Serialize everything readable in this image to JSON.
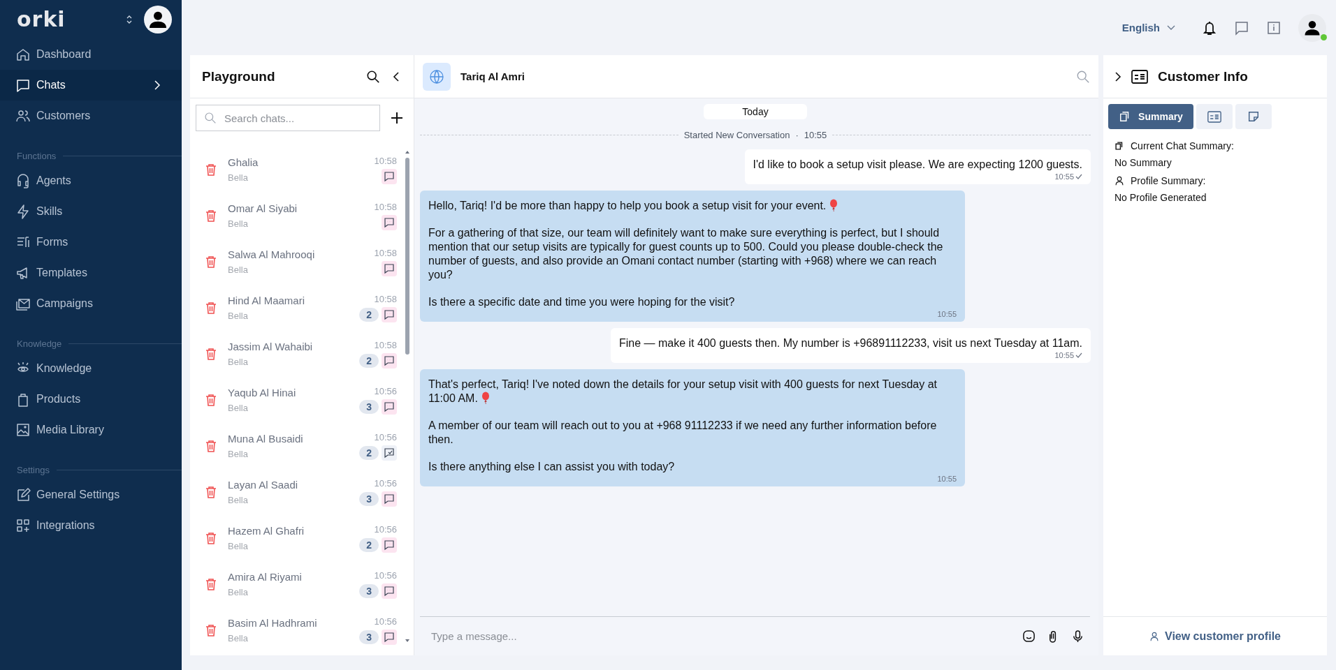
{
  "sidebar": {
    "logo": "orki",
    "sections": [
      {
        "items": [
          {
            "label": "Dashboard",
            "selected": false,
            "expandable": false
          },
          {
            "label": "Chats",
            "selected": true,
            "expandable": true
          },
          {
            "label": "Customers",
            "selected": false,
            "expandable": false
          }
        ]
      },
      {
        "title": "Functions",
        "items": [
          {
            "label": "Agents",
            "selected": false,
            "expandable": false
          },
          {
            "label": "Skills",
            "selected": false,
            "expandable": false
          },
          {
            "label": "Forms",
            "selected": false,
            "expandable": false
          },
          {
            "label": "Templates",
            "selected": false,
            "expandable": false
          },
          {
            "label": "Campaigns",
            "selected": false,
            "expandable": false
          }
        ]
      },
      {
        "title": "Knowledge",
        "items": [
          {
            "label": "Knowledge",
            "selected": false,
            "expandable": false
          },
          {
            "label": "Products",
            "selected": false,
            "expandable": false
          },
          {
            "label": "Media Library",
            "selected": false,
            "expandable": false
          }
        ]
      },
      {
        "title": "Settings",
        "items": [
          {
            "label": "General Settings",
            "selected": false,
            "expandable": false
          },
          {
            "label": "Integrations",
            "selected": false,
            "expandable": false
          }
        ]
      }
    ]
  },
  "top_bar": {
    "language": "English",
    "user_online": true
  },
  "chat_list": {
    "title": "Playground",
    "search": {
      "placeholder": "Search chats..."
    },
    "chats": [
      {
        "name": "Ghalia",
        "agent": "Bella",
        "time": "10:58",
        "kind": "open"
      },
      {
        "name": "Omar Al Siyabi",
        "agent": "Bella",
        "time": "10:58",
        "kind": "open"
      },
      {
        "name": "Salwa Al Mahrooqi",
        "agent": "Bella",
        "time": "10:58",
        "kind": "open"
      },
      {
        "name": "Hind Al Maamari",
        "agent": "Bella",
        "time": "10:58",
        "unread": "2",
        "kind": "open"
      },
      {
        "name": "Jassim Al Wahaibi",
        "agent": "Bella",
        "time": "10:58",
        "unread": "2",
        "kind": "open"
      },
      {
        "name": "Yaqub Al Hinai",
        "agent": "Bella",
        "time": "10:56",
        "unread": "3",
        "kind": "open"
      },
      {
        "name": "Muna Al Busaidi",
        "agent": "Bella",
        "time": "10:56",
        "unread": "2",
        "kind": "handled"
      },
      {
        "name": "Layan Al Saadi",
        "agent": "Bella",
        "time": "10:56",
        "unread": "3",
        "kind": "open"
      },
      {
        "name": "Hazem Al Ghafri",
        "agent": "Bella",
        "time": "10:56",
        "unread": "2",
        "kind": "open"
      },
      {
        "name": "Amira Al Riyami",
        "agent": "Bella",
        "time": "10:56",
        "unread": "3",
        "kind": "open"
      },
      {
        "name": "Basim Al Hadhrami",
        "agent": "Bella",
        "time": "10:56",
        "unread": "3",
        "kind": "open"
      }
    ]
  },
  "conversation": {
    "contact": "Tariq Al Amri",
    "date": "Today",
    "started": "Started New Conversation",
    "separator": "·",
    "started_time": "10:55",
    "messages": [
      {
        "kind": "customer",
        "paragraphs": [
          {
            "text": "I'd like to book a setup visit please. We are expecting 1200 guests.",
            "balloon": false
          }
        ],
        "time": "10:55"
      },
      {
        "kind": "agent",
        "paragraphs": [
          {
            "text": "Hello, Tariq! I'd be more than happy to help you book a setup visit for your event.",
            "balloon": true
          },
          {
            "text": "For a gathering of that size, our team will definitely want to make sure everything is perfect, but I should mention that our setup visits are typically for guest counts up to 500. Could you please double-check the number of guests, and also provide an Omani contact number (starting with +968) where we can reach you?",
            "balloon": false
          },
          {
            "text": "Is there a specific date and time you were hoping for the visit?",
            "balloon": false
          }
        ],
        "time": "10:55"
      },
      {
        "kind": "customer",
        "paragraphs": [
          {
            "text": "Fine — make it 400 guests then. My number is +96891112233, visit us next Tuesday at 11am.",
            "balloon": false
          }
        ],
        "time": "10:55"
      },
      {
        "kind": "agent",
        "paragraphs": [
          {
            "text": "That's perfect, Tariq! I've noted down the details for your setup visit with 400 guests for next Tuesday at 11:00 AM.",
            "balloon": true
          },
          {
            "text": "A member of our team will reach out to you at +968 91112233 if we need any further information before then.",
            "balloon": false
          },
          {
            "text": "Is there anything else I can assist you with today?",
            "balloon": false
          }
        ],
        "time": "10:55"
      }
    ],
    "composer": {
      "placeholder": "Type a message..."
    }
  },
  "customer_info": {
    "title": "Customer Info",
    "tabs": [
      {
        "label": "Summary",
        "selected": true
      },
      {
        "selected": false
      },
      {
        "selected": false
      }
    ],
    "sections": [
      {
        "heading": "Current Chat Summary:",
        "value": "No Summary"
      },
      {
        "heading": "Profile Summary:",
        "value": "No Profile Generated"
      }
    ],
    "profile_link": "View customer profile"
  }
}
